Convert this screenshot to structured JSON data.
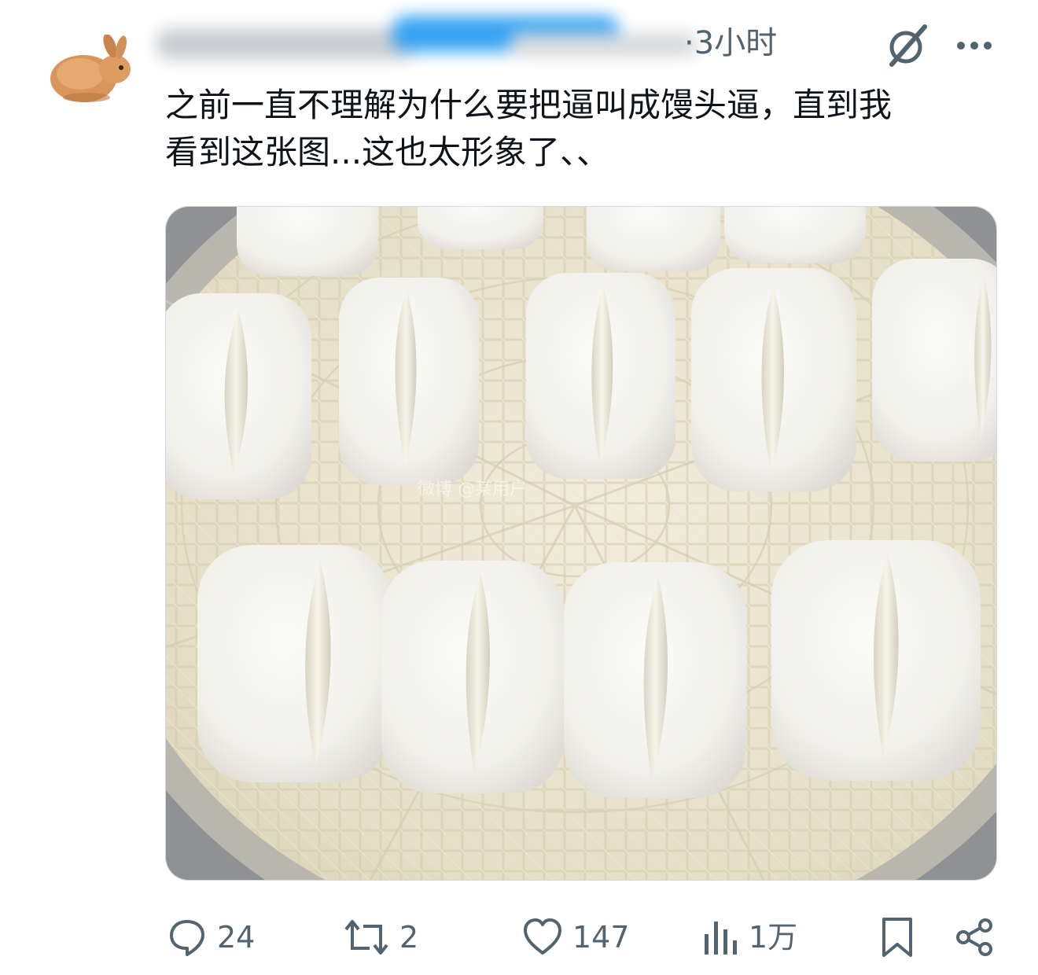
{
  "post": {
    "timestamp": "3小时",
    "text": "之前一直不理解为什么要把逼叫成馒头逼，直到我\n看到这张图...这也太形象了、、",
    "image": {
      "watermark": "微博 @某用户"
    }
  },
  "actions": {
    "reply_count": "24",
    "repost_count": "2",
    "like_count": "147",
    "view_count": "1万"
  },
  "icons": {
    "grok": "grok-slash-icon",
    "more": "more-dots-icon",
    "reply": "reply-bubble-icon",
    "repost": "repost-arrows-icon",
    "like": "heart-icon",
    "views": "bar-chart-icon",
    "bookmark": "bookmark-icon",
    "share": "share-icon"
  },
  "colors": {
    "text_primary": "#0f1419",
    "text_secondary": "#536471",
    "border": "#cfd9de",
    "basket": "#e6dfc7",
    "bun": "#f4f3ef"
  }
}
